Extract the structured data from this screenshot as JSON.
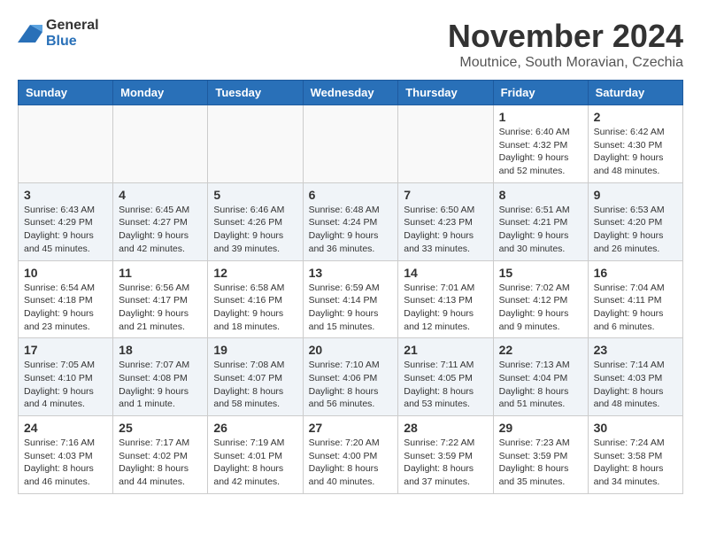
{
  "logo": {
    "general": "General",
    "blue": "Blue"
  },
  "title": "November 2024",
  "subtitle": "Moutnice, South Moravian, Czechia",
  "days_of_week": [
    "Sunday",
    "Monday",
    "Tuesday",
    "Wednesday",
    "Thursday",
    "Friday",
    "Saturday"
  ],
  "weeks": [
    [
      {
        "day": "",
        "info": ""
      },
      {
        "day": "",
        "info": ""
      },
      {
        "day": "",
        "info": ""
      },
      {
        "day": "",
        "info": ""
      },
      {
        "day": "",
        "info": ""
      },
      {
        "day": "1",
        "info": "Sunrise: 6:40 AM\nSunset: 4:32 PM\nDaylight: 9 hours\nand 52 minutes."
      },
      {
        "day": "2",
        "info": "Sunrise: 6:42 AM\nSunset: 4:30 PM\nDaylight: 9 hours\nand 48 minutes."
      }
    ],
    [
      {
        "day": "3",
        "info": "Sunrise: 6:43 AM\nSunset: 4:29 PM\nDaylight: 9 hours\nand 45 minutes."
      },
      {
        "day": "4",
        "info": "Sunrise: 6:45 AM\nSunset: 4:27 PM\nDaylight: 9 hours\nand 42 minutes."
      },
      {
        "day": "5",
        "info": "Sunrise: 6:46 AM\nSunset: 4:26 PM\nDaylight: 9 hours\nand 39 minutes."
      },
      {
        "day": "6",
        "info": "Sunrise: 6:48 AM\nSunset: 4:24 PM\nDaylight: 9 hours\nand 36 minutes."
      },
      {
        "day": "7",
        "info": "Sunrise: 6:50 AM\nSunset: 4:23 PM\nDaylight: 9 hours\nand 33 minutes."
      },
      {
        "day": "8",
        "info": "Sunrise: 6:51 AM\nSunset: 4:21 PM\nDaylight: 9 hours\nand 30 minutes."
      },
      {
        "day": "9",
        "info": "Sunrise: 6:53 AM\nSunset: 4:20 PM\nDaylight: 9 hours\nand 26 minutes."
      }
    ],
    [
      {
        "day": "10",
        "info": "Sunrise: 6:54 AM\nSunset: 4:18 PM\nDaylight: 9 hours\nand 23 minutes."
      },
      {
        "day": "11",
        "info": "Sunrise: 6:56 AM\nSunset: 4:17 PM\nDaylight: 9 hours\nand 21 minutes."
      },
      {
        "day": "12",
        "info": "Sunrise: 6:58 AM\nSunset: 4:16 PM\nDaylight: 9 hours\nand 18 minutes."
      },
      {
        "day": "13",
        "info": "Sunrise: 6:59 AM\nSunset: 4:14 PM\nDaylight: 9 hours\nand 15 minutes."
      },
      {
        "day": "14",
        "info": "Sunrise: 7:01 AM\nSunset: 4:13 PM\nDaylight: 9 hours\nand 12 minutes."
      },
      {
        "day": "15",
        "info": "Sunrise: 7:02 AM\nSunset: 4:12 PM\nDaylight: 9 hours\nand 9 minutes."
      },
      {
        "day": "16",
        "info": "Sunrise: 7:04 AM\nSunset: 4:11 PM\nDaylight: 9 hours\nand 6 minutes."
      }
    ],
    [
      {
        "day": "17",
        "info": "Sunrise: 7:05 AM\nSunset: 4:10 PM\nDaylight: 9 hours\nand 4 minutes."
      },
      {
        "day": "18",
        "info": "Sunrise: 7:07 AM\nSunset: 4:08 PM\nDaylight: 9 hours\nand 1 minute."
      },
      {
        "day": "19",
        "info": "Sunrise: 7:08 AM\nSunset: 4:07 PM\nDaylight: 8 hours\nand 58 minutes."
      },
      {
        "day": "20",
        "info": "Sunrise: 7:10 AM\nSunset: 4:06 PM\nDaylight: 8 hours\nand 56 minutes."
      },
      {
        "day": "21",
        "info": "Sunrise: 7:11 AM\nSunset: 4:05 PM\nDaylight: 8 hours\nand 53 minutes."
      },
      {
        "day": "22",
        "info": "Sunrise: 7:13 AM\nSunset: 4:04 PM\nDaylight: 8 hours\nand 51 minutes."
      },
      {
        "day": "23",
        "info": "Sunrise: 7:14 AM\nSunset: 4:03 PM\nDaylight: 8 hours\nand 48 minutes."
      }
    ],
    [
      {
        "day": "24",
        "info": "Sunrise: 7:16 AM\nSunset: 4:03 PM\nDaylight: 8 hours\nand 46 minutes."
      },
      {
        "day": "25",
        "info": "Sunrise: 7:17 AM\nSunset: 4:02 PM\nDaylight: 8 hours\nand 44 minutes."
      },
      {
        "day": "26",
        "info": "Sunrise: 7:19 AM\nSunset: 4:01 PM\nDaylight: 8 hours\nand 42 minutes."
      },
      {
        "day": "27",
        "info": "Sunrise: 7:20 AM\nSunset: 4:00 PM\nDaylight: 8 hours\nand 40 minutes."
      },
      {
        "day": "28",
        "info": "Sunrise: 7:22 AM\nSunset: 3:59 PM\nDaylight: 8 hours\nand 37 minutes."
      },
      {
        "day": "29",
        "info": "Sunrise: 7:23 AM\nSunset: 3:59 PM\nDaylight: 8 hours\nand 35 minutes."
      },
      {
        "day": "30",
        "info": "Sunrise: 7:24 AM\nSunset: 3:58 PM\nDaylight: 8 hours\nand 34 minutes."
      }
    ]
  ]
}
